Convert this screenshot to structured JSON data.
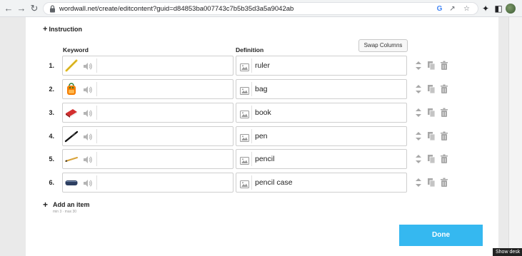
{
  "browser": {
    "url": "wordwall.net/create/editcontent?guid=d84853ba007743c7b5b35d3a5a9042ab"
  },
  "editor": {
    "instruction_label": "Instruction",
    "keyword_header": "Keyword",
    "definition_header": "Definition",
    "swap_label": "Swap Columns",
    "items": [
      {
        "number": "1.",
        "image": "ruler",
        "definition": "ruler"
      },
      {
        "number": "2.",
        "image": "bag",
        "definition": "bag"
      },
      {
        "number": "3.",
        "image": "book",
        "definition": "book"
      },
      {
        "number": "4.",
        "image": "pen",
        "definition": "pen"
      },
      {
        "number": "5.",
        "image": "pencil",
        "definition": "pencil"
      },
      {
        "number": "6.",
        "image": "pencil-case",
        "definition": "pencil case"
      }
    ],
    "add_item_label": "Add an item",
    "add_item_hint": "min 3 · max 30",
    "done_label": "Done"
  },
  "tooltip": {
    "text": "Show desk"
  },
  "colors": {
    "accent": "#35b8f0"
  }
}
